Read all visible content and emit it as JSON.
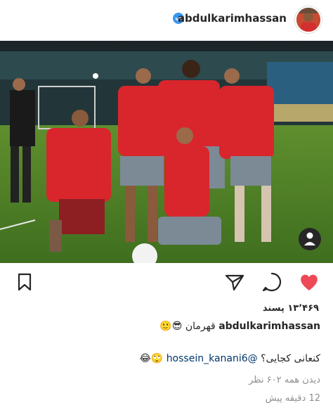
{
  "post": {
    "username": "abdulkarimhassan",
    "verified": true,
    "likes_text": "۱۳٬۴۶۹ پسند",
    "caption": {
      "username": "abdulkarimhassan",
      "text": "قهرمان",
      "emojis": "😎🙂"
    },
    "comment": {
      "text": "کنعانی کجایی؟",
      "mention": "@hossein_kanani6",
      "emojis": "🙄😂"
    },
    "views_text": "دیدن همه ۶۰۲ نظر",
    "time_text": "12 دقیقه پیش"
  },
  "icons": {
    "verified": "verified-badge-icon",
    "profile": "user-profile-icon",
    "bookmark": "bookmark-icon",
    "share": "send-icon",
    "comment": "comment-icon",
    "like": "heart-icon"
  },
  "colors": {
    "like": "#ed4956",
    "verified": "#3897f0",
    "mention": "#00376b",
    "muted": "#8e8e8e"
  }
}
